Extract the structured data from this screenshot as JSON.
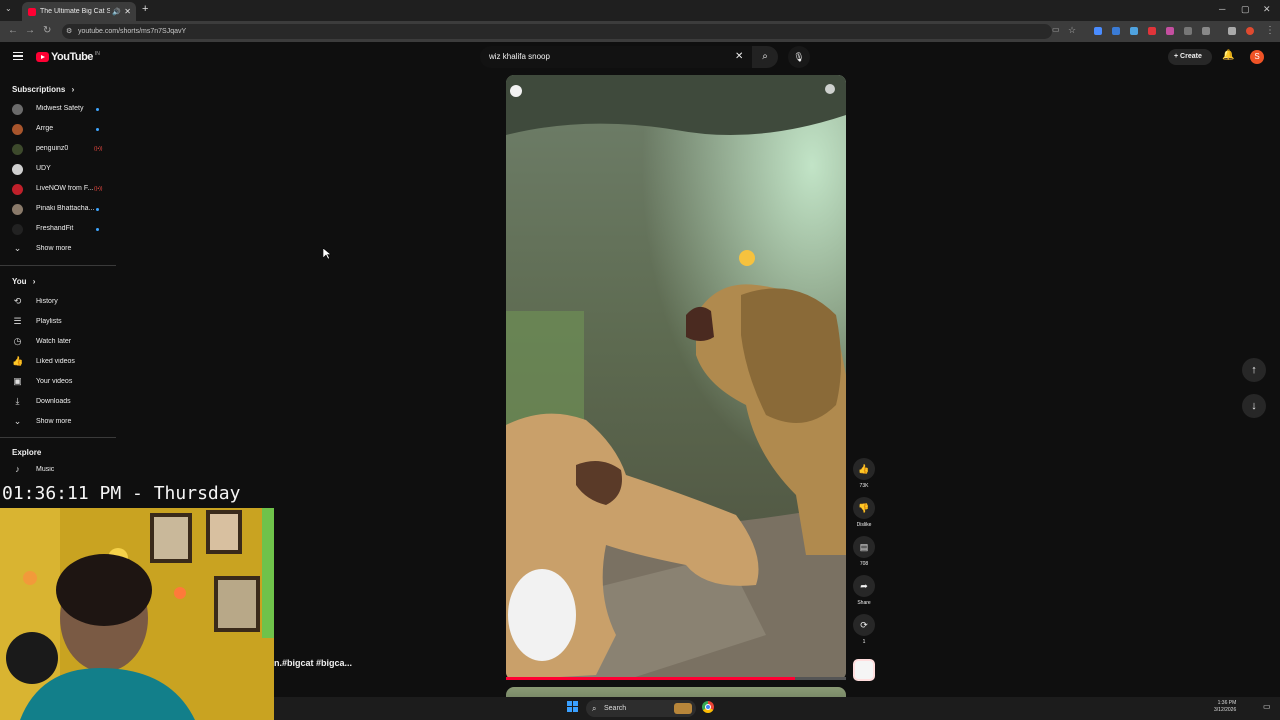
{
  "browser": {
    "tab_title": "The Ultimate Big Cat Show",
    "url": "youtube.com/shorts/ms7n7SJqavY"
  },
  "header": {
    "logo_text": "YouTube",
    "logo_superscript": "IN",
    "search_value": "wiz khalifa snoop",
    "create_label": "Create",
    "avatar_letter": "S"
  },
  "sidebar": {
    "subscriptions_title": "Subscriptions",
    "subscriptions": [
      {
        "label": "Midwest Safety",
        "status": "dot",
        "color": "#6b6b6b"
      },
      {
        "label": "Arrge",
        "status": "dot",
        "color": "#a8552c"
      },
      {
        "label": "penguinz0",
        "status": "live",
        "color": "#3d4a2c"
      },
      {
        "label": "UDY",
        "status": "",
        "color": "#cfcfcf"
      },
      {
        "label": "LiveNOW from F...",
        "status": "live",
        "color": "#c0202a"
      },
      {
        "label": "Pinaki Bhattacha...",
        "status": "dot",
        "color": "#8a7a6a"
      },
      {
        "label": "FreshandFit",
        "status": "dot",
        "color": "#222222"
      }
    ],
    "show_more_1": "Show more",
    "you_title": "You",
    "you_items": [
      {
        "label": "History",
        "icon": "history-icon",
        "glyph": "⟲"
      },
      {
        "label": "Playlists",
        "icon": "playlists-icon",
        "glyph": "☰"
      },
      {
        "label": "Watch later",
        "icon": "watch-later-icon",
        "glyph": "◷"
      },
      {
        "label": "Liked videos",
        "icon": "like-icon",
        "glyph": "👍"
      },
      {
        "label": "Your videos",
        "icon": "your-videos-icon",
        "glyph": "▣"
      },
      {
        "label": "Downloads",
        "icon": "download-icon",
        "glyph": "⤓"
      }
    ],
    "show_more_2": "Show more",
    "explore_title": "Explore",
    "explore_items": [
      {
        "label": "Music",
        "icon": "music-icon",
        "glyph": "♪"
      }
    ]
  },
  "short": {
    "caption_fragment": "n.#bigcat #bigca...",
    "progress": 0.85
  },
  "actions": {
    "likes": "73K",
    "dislike": "Dislike",
    "comments": "708",
    "share": "Share",
    "remix": "1"
  },
  "overlay": {
    "clock": "01:36:11 PM - Thursday"
  },
  "taskbar": {
    "search_label": "Search",
    "time": "1:36 PM",
    "date": "3/12/2026"
  },
  "colors": {
    "brand_red": "#ff0033",
    "background": "#0f0f0f",
    "accent_blue": "#3ea6ff"
  }
}
